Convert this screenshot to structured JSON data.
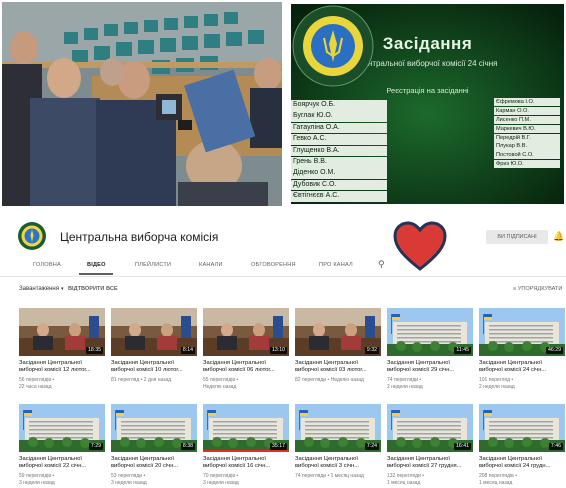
{
  "screen": {
    "title": "Засідання",
    "subtitle": "Центральної виборчої комісії 24 січня",
    "registration": "Реєстрація на засіданні",
    "names_left": [
      "Боярчук О.Б.",
      "Буглак Ю.О.",
      "Гатауліна О.А.",
      "Гевко А.С.",
      "Глущенко В.А.",
      "Грень В.В.",
      "Діденко О.М.",
      "Дубовик С.О.",
      "Євтігнєєв А.С."
    ],
    "names_right": [
      "Єфремова І.О.",
      "Карман О.О.",
      "Лисенко П.М.",
      "Маркевич В.Ю.",
      "Передрій В.Г.",
      "Плукар В.В.",
      "Постовой С.О.",
      "Фриз Ю.О."
    ]
  },
  "channel": {
    "name": "Центральна виборча комісія",
    "subscribe_label": "ВИ ПІДПИСАНІ",
    "tabs": [
      "ГОЛОВНА",
      "ВІДЕО",
      "ПЛЕЙЛИСТИ",
      "КАНАЛИ",
      "ОБГОВОРЕННЯ",
      "ПРО КАНАЛ"
    ],
    "active_tab": "ВІДЕО",
    "shelf_title": "Завантаження",
    "play_all": "ВІДТВОРИТИ ВСЕ",
    "sort_label": "УПОРЯДКУВАТИ"
  },
  "colors": {
    "youtube_red": "#e52d27",
    "heart": "#d93a36",
    "screen_bg": "#0a2a12"
  },
  "videos": [
    {
      "title": "Засідання Центральної виборчої комісії 12 лютог...",
      "views": "56 переглядів •",
      "age": "22 часа назад",
      "duration": "18:35",
      "thumb": "meeting",
      "progress": 0
    },
    {
      "title": "Засідання Центральної виборчої комісії 10 лютог...",
      "views": "81 перегляд • 2 дня назад",
      "age": "",
      "duration": "8:14",
      "thumb": "meeting",
      "progress": 0
    },
    {
      "title": "Засідання Центральної виборчої комісії 06 лютог...",
      "views": "55 переглядів •",
      "age": "Неделю назад",
      "duration": "13:10",
      "thumb": "meeting",
      "progress": 0
    },
    {
      "title": "Засідання Центральної виборчої комісії 03 лютог...",
      "views": "82 перегляди • Неделю назад",
      "age": "",
      "duration": "9:32",
      "thumb": "meeting",
      "progress": 0
    },
    {
      "title": "Засідання Центральної виборчої комісії 29 січн...",
      "views": "74 перегляди •",
      "age": "2 недели назад",
      "duration": "11:45",
      "thumb": "building",
      "progress": 0
    },
    {
      "title": "Засідання Центральної виборчої комісії 24 січн...",
      "views": "101 перегляд •",
      "age": "2 недели назад",
      "duration": "46:29",
      "thumb": "building",
      "progress": 0
    },
    {
      "title": "Засідання Центральної виборчої комісії 22 січн...",
      "views": "59 переглядів •",
      "age": "3 недели назад",
      "duration": "7:29",
      "thumb": "building",
      "progress": 0
    },
    {
      "title": "Засідання Центральної виборчої комісії 20 січн...",
      "views": "53 перегляди •",
      "age": "3 недели назад",
      "duration": "8:38",
      "thumb": "building",
      "progress": 0
    },
    {
      "title": "Засідання Центральної виборчої комісії 16 січн...",
      "views": "70 переглядів •",
      "age": "3 недели назад",
      "duration": "35:17",
      "thumb": "building",
      "progress": 1
    },
    {
      "title": "Засідання Центральної виборчої комісії 3 січн...",
      "views": "74 перегляди • 1 месяц назад",
      "age": "",
      "duration": "7:24",
      "thumb": "building",
      "progress": 0
    },
    {
      "title": "Засідання Центральної виборчої комісії 27 грудня...",
      "views": "132 перегляди •",
      "age": "1 месяц назад",
      "duration": "16:41",
      "thumb": "building",
      "progress": 0
    },
    {
      "title": "Засідання Центральної виборчої комісії 24 грудн...",
      "views": "208 переглядів •",
      "age": "1 месяц назад",
      "duration": "7:46",
      "thumb": "building",
      "progress": 0
    }
  ]
}
